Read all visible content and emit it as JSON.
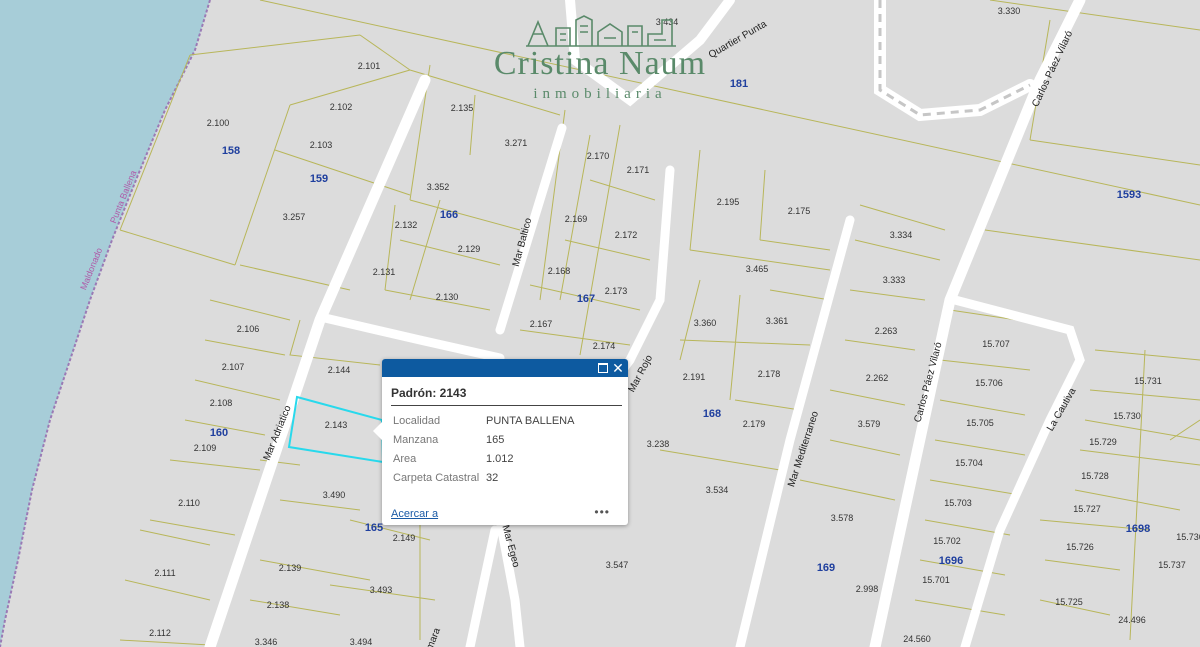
{
  "logo": {
    "name": "Cristina Naum",
    "subtitle": "inmobiliaria",
    "icon": "skyline-icon"
  },
  "popup": {
    "title": "Padrón: 2143",
    "fields": [
      {
        "key": "Localidad",
        "value": "PUNTA BALLENA"
      },
      {
        "key": "Manzana",
        "value": "165"
      },
      {
        "key": "Area",
        "value": "1.012"
      },
      {
        "key": "Carpeta Catastral",
        "value": "32"
      }
    ],
    "zoom_link": "Acercar a",
    "more_label": "•••",
    "maximize_icon": "maximize-icon",
    "close_label": "✕"
  },
  "map": {
    "department_labels": [
      "Maldonado",
      "Punta Ballena"
    ],
    "streets": [
      "Mar Adriatico",
      "Mar Baltico",
      "Mar Rojo",
      "Mar Mediterraneo",
      "Mar Egeo",
      "Carlos Páez Vilaró",
      "Carlos Páez Vilaró",
      "La Cautiva",
      "Quartier Punta",
      "mara"
    ],
    "blocks": [
      "158",
      "159",
      "166",
      "181",
      "1593",
      "167",
      "160",
      "165",
      "168",
      "169",
      "1696",
      "1698"
    ],
    "lots": [
      "2.101",
      "2.100",
      "2.102",
      "2.103",
      "3.257",
      "2.135",
      "3.271",
      "3.352",
      "2.132",
      "2.129",
      "2.131",
      "2.130",
      "3.434",
      "3.330",
      "2.170",
      "2.171",
      "2.169",
      "2.172",
      "2.168",
      "2.173",
      "2.167",
      "2.174",
      "2.195",
      "2.175",
      "3.334",
      "3.465",
      "3.333",
      "3.360",
      "3.361",
      "2.263",
      "2.191",
      "2.178",
      "2.262",
      "2.179",
      "3.579",
      "3.238",
      "3.534",
      "3.578",
      "3.547",
      "2.998",
      "15.707",
      "15.706",
      "15.705",
      "15.704",
      "15.703",
      "15.702",
      "15.701",
      "24.560",
      "15.731",
      "15.730",
      "15.729",
      "15.728",
      "15.727",
      "15.726",
      "15.725",
      "15.737",
      "15.736",
      "24.496",
      "2.106",
      "2.107",
      "2.108",
      "2.109",
      "2.110",
      "2.111",
      "2.112",
      "2.144",
      "2.143",
      "3.490",
      "2.149",
      "2.139",
      "2.138",
      "3.493",
      "3.346",
      "3.494"
    ]
  }
}
